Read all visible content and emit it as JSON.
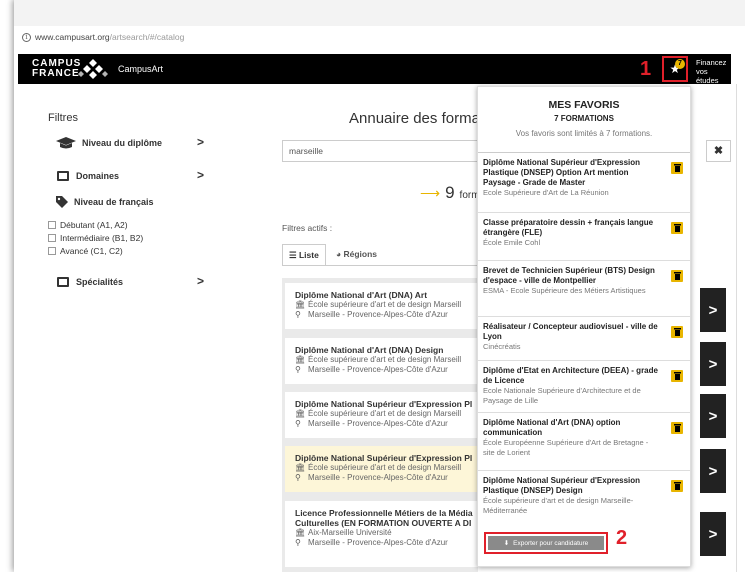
{
  "browser": {
    "url_main": "www.campusart.org",
    "url_rest": "/artsearch/#/catalog"
  },
  "navbar": {
    "logo_line1": "CAMPUS",
    "logo_line2": "FRANCE",
    "brand": "CampusArt",
    "annotation_1": "1",
    "fav_count": "7",
    "financez_line1": "Financez",
    "financez_line2": "vos études"
  },
  "filters": {
    "title": "Filtres",
    "niveau_diplome": "Niveau du diplôme",
    "domaines": "Domaines",
    "niveau_francais": "Niveau de français",
    "levels": [
      "Débutant (A1, A2)",
      "Intermédiaire (B1, B2)",
      "Avancé (C1, C2)"
    ],
    "specialites": "Spécialités"
  },
  "main": {
    "title": "Annuaire des forma",
    "search_value": "marseille",
    "clear": "✖",
    "count_number": "9",
    "count_label": "form",
    "filtres_actifs": "Filtres actifs :",
    "tab_liste": "Liste",
    "tab_regions": "Régions"
  },
  "results": [
    {
      "title": "Diplôme National d'Art (DNA) Art",
      "school": "École supérieure d'art et de design Marseill",
      "location": "Marseille - Provence-Alpes-Côte d'Azur"
    },
    {
      "title": "Diplôme National d'Art (DNA) Design",
      "school": "École supérieure d'art et de design Marseill",
      "location": "Marseille - Provence-Alpes-Côte d'Azur"
    },
    {
      "title": "Diplôme National Supérieur d'Expression Pl",
      "school": "École supérieure d'art et de design Marseill",
      "location": "Marseille - Provence-Alpes-Côte d'Azur"
    },
    {
      "title": "Diplôme National Supérieur d'Expression Pl",
      "school": "École supérieure d'art et de design Marseill",
      "location": "Marseille - Provence-Alpes-Côte d'Azur"
    },
    {
      "title_line1": "Licence Professionnelle Métiers de la Média",
      "title_line2": "Culturelles (EN FORMATION OUVERTE A DI",
      "school": "Aix-Marseille Université",
      "location": "Marseille - Provence-Alpes-Côte d'Azur"
    }
  ],
  "favorites": {
    "title": "MES FAVORIS",
    "subtitle": "7 FORMATIONS",
    "note": "Vos favoris sont limités à 7 formations.",
    "items": [
      {
        "title": "Diplôme National Supérieur d'Expression Plastique (DNSEP) Option Art mention Paysage - Grade de Master",
        "school": "Ecole Supérieure d'Art de La Réunion"
      },
      {
        "title": "Classe préparatoire dessin + français langue étrangère (FLE)",
        "school": "École Emile Cohl"
      },
      {
        "title": "Brevet de Technicien Supérieur (BTS) Design d'espace - ville de Montpellier",
        "school": "ESMA - Ecole Supérieure des Métiers Artistiques"
      },
      {
        "title": "Réalisateur / Concepteur audiovisuel - ville de Lyon",
        "school": "Cinécréatis"
      },
      {
        "title": "Diplôme d'Etat en Architecture (DEEA) - grade de Licence",
        "school": "Ecole Nationale Supérieure d'Architecture et de Paysage de Lille"
      },
      {
        "title": "Diplôme National d'Art (DNA) option communication",
        "school": "École Européenne Supérieure d'Art de Bretagne - site de Lorient"
      },
      {
        "title": "Diplôme National Supérieur d'Expression Plastique (DNSEP) Design",
        "school": "École supérieure d'art et de design Marseille-Méditerranée"
      }
    ],
    "export_label": "Exporter pour candidature",
    "annotation_2": "2"
  },
  "colors": {
    "accent": "#e8b500",
    "annotation": "#e0202a",
    "navbar": "#000000"
  }
}
